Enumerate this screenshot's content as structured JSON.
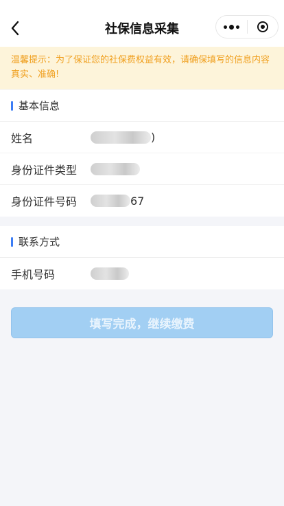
{
  "nav": {
    "title": "社保信息采集",
    "back_icon": "chevron-left-icon",
    "menu_icon": "more-dots-icon",
    "close_icon": "target-icon"
  },
  "notice": {
    "text": "温馨提示：为了保证您的社保费权益有效，请确保填写的信息内容真实、准确!"
  },
  "basic_info": {
    "title": "基本信息",
    "rows": [
      {
        "label": "姓名",
        "value_suffix": ")"
      },
      {
        "label": "身份证件类型",
        "value_suffix": ""
      },
      {
        "label": "身份证件号码",
        "value_suffix": "67"
      }
    ]
  },
  "contact": {
    "title": "联系方式",
    "rows": [
      {
        "label": "手机号码",
        "value_suffix": ""
      }
    ]
  },
  "submit": {
    "label": "填写完成，继续缴费"
  },
  "colors": {
    "accent": "#3b7cf5",
    "notice_text": "#f0a020",
    "notice_bg": "#fdf4da",
    "button_bg": "#a2cff3"
  }
}
